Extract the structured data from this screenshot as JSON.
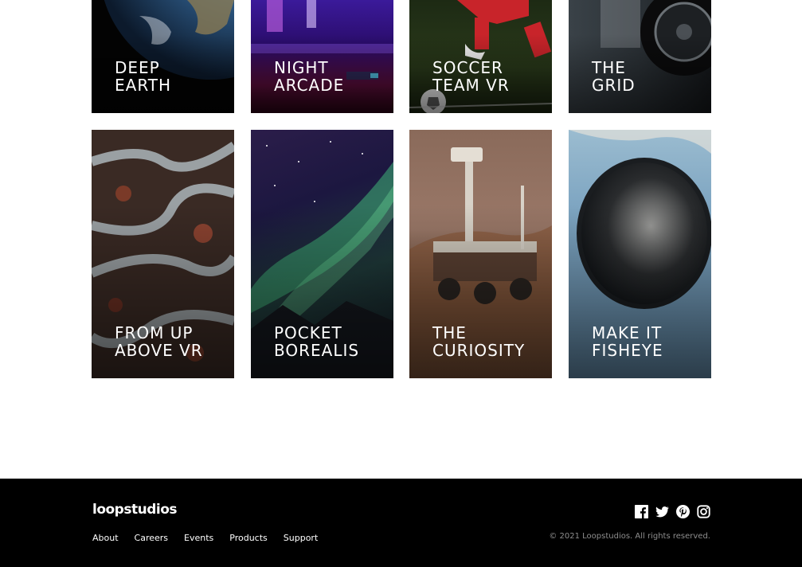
{
  "creations": [
    {
      "line1": "DEEP",
      "line2": "EARTH"
    },
    {
      "line1": "NIGHT",
      "line2": "ARCADE"
    },
    {
      "line1": "SOCCER",
      "line2": "TEAM VR"
    },
    {
      "line1": "THE",
      "line2": "GRID"
    },
    {
      "line1": "FROM UP",
      "line2": "ABOVE VR"
    },
    {
      "line1": "POCKET",
      "line2": "BOREALIS"
    },
    {
      "line1": "THE",
      "line2": "CURIOSITY"
    },
    {
      "line1": "MAKE IT",
      "line2": "FISHEYE"
    }
  ],
  "footer": {
    "logo": "loopstudios",
    "nav": [
      "About",
      "Careers",
      "Events",
      "Products",
      "Support"
    ],
    "social": [
      "facebook-icon",
      "twitter-icon",
      "pinterest-icon",
      "instagram-icon"
    ],
    "copyright": "© 2021 Loopstudios. All rights reserved."
  }
}
